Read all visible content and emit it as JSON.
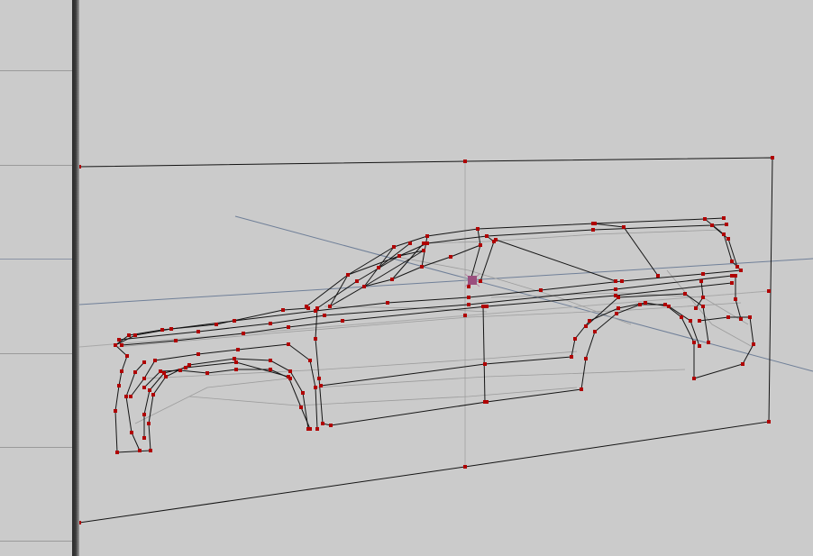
{
  "app": {
    "panel_rows": 6,
    "colors": {
      "background": "#cbcbcb",
      "wire": "#141414",
      "wire_faint": "#9c9c9c",
      "vertex": "#b00000",
      "axis": "#6f7f98",
      "pivot": "#9b4f7e",
      "divider": "#2b2b2b"
    }
  },
  "scene": {
    "objects": [
      {
        "name": "reference-plane",
        "type": "plane"
      },
      {
        "name": "car-body",
        "type": "mesh",
        "shading": "wireframe"
      }
    ],
    "selection": {
      "mode": "vertex",
      "object": "car-body"
    },
    "icons": {
      "pivot": "transform-pivot-icon"
    }
  }
}
